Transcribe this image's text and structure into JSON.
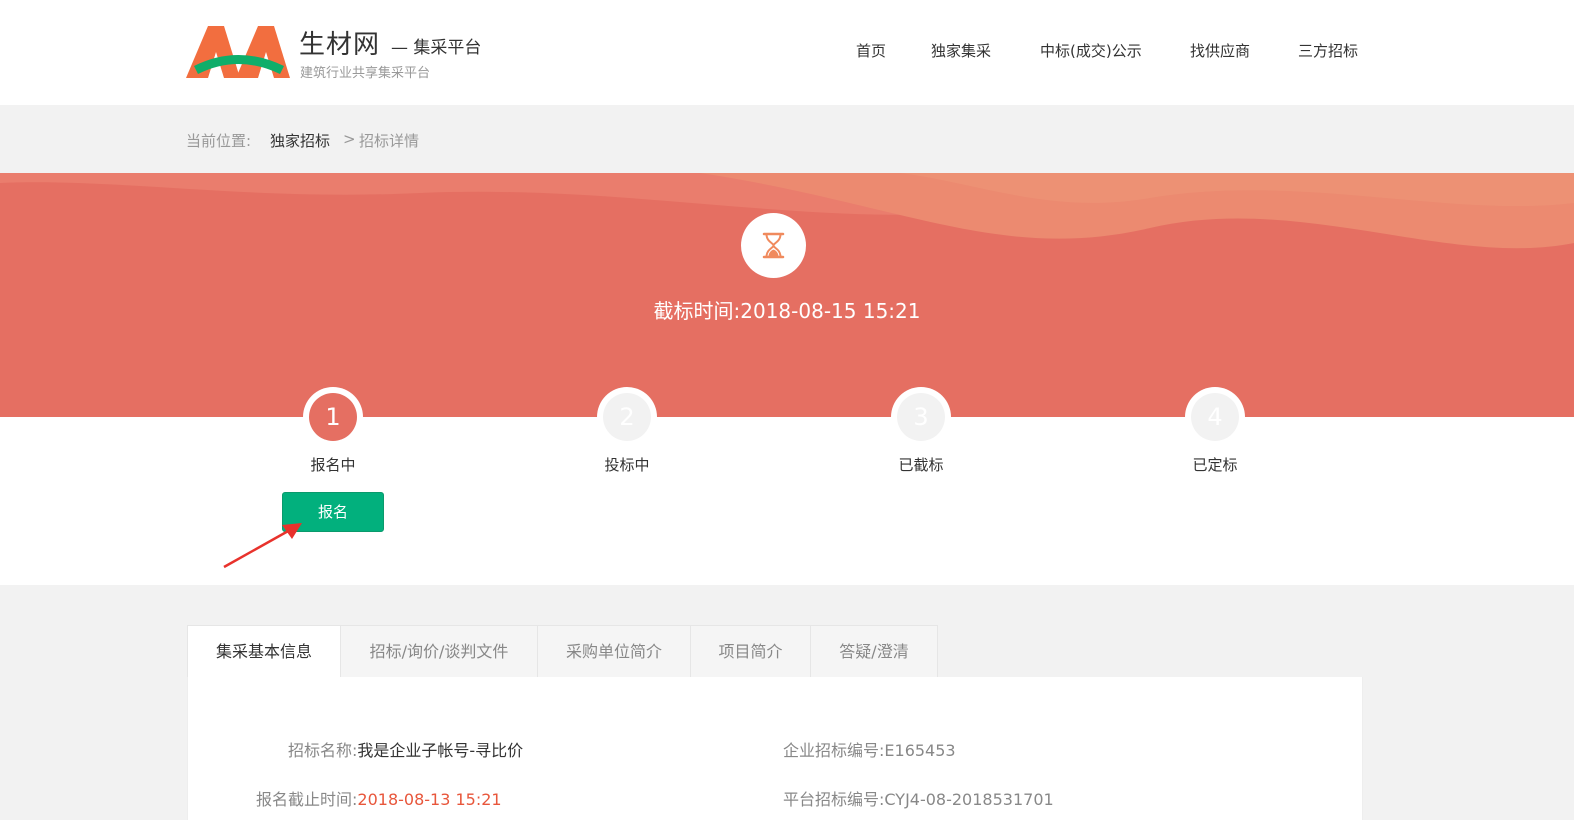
{
  "header": {
    "brand_name": "生材网",
    "brand_sub": "— 集采平台",
    "slogan": "建筑行业共享集采平台",
    "nav": [
      "首页",
      "独家集采",
      "中标(成交)公示",
      "找供应商",
      "三方招标"
    ]
  },
  "breadcrumb": {
    "prefix": "当前位置:",
    "level1": "独家招标",
    "separator": ">",
    "level2": "招标详情"
  },
  "banner": {
    "icon": "hourglass-icon",
    "deadline_label": "截标时间:",
    "deadline_value": "2018-08-15 15:21"
  },
  "steps": [
    {
      "number": "1",
      "label": "报名中",
      "active": true
    },
    {
      "number": "2",
      "label": "投标中",
      "active": false
    },
    {
      "number": "3",
      "label": "已截标",
      "active": false
    },
    {
      "number": "4",
      "label": "已定标",
      "active": false
    }
  ],
  "actions": {
    "signup_label": "报名"
  },
  "tabs": [
    "集采基本信息",
    "招标/询价/谈判文件",
    "采购单位简介",
    "项目简介",
    "答疑/澄清"
  ],
  "info": {
    "name_label": "招标名称:",
    "name_value": "我是企业子帐号-寻比价",
    "company_code_label": "企业招标编号:",
    "company_code_value": "E165453",
    "signup_deadline_label": "报名截止时间:",
    "signup_deadline_value": "2018-08-13 15:21",
    "platform_code_label": "平台招标编号:",
    "platform_code_value": "CYJ4-08-2018531701"
  },
  "colors": {
    "accent": "#e56f62",
    "button": "#02b07d",
    "highlight_text": "#e8563b"
  }
}
